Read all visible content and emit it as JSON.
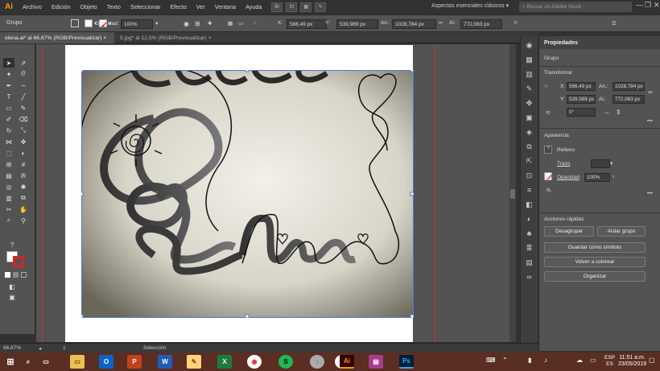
{
  "app": {
    "logo": "Ai",
    "menu": [
      "Archivo",
      "Edición",
      "Objeto",
      "Texto",
      "Seleccionar",
      "Efecto",
      "Ver",
      "Ventana",
      "Ayuda"
    ],
    "bridge_icons": [
      "Br",
      "St"
    ],
    "workspace": "Aspectos esenciales clásicos",
    "search_placeholder": "Buscar en Adobe Stock",
    "window_controls": [
      "—",
      "❐",
      "✕"
    ]
  },
  "control_bar": {
    "selection_label": "Grupo",
    "opacity_label": "Opacidad:",
    "opacity_value": "100%",
    "x_label": "X:",
    "x_value": "566,49 px",
    "y_label": "Y:",
    "y_value": "539,989 px",
    "w_label": "An.:",
    "w_value": "1028,784 px",
    "h_label": "Al.:",
    "h_value": "772,063 px"
  },
  "tabs": [
    {
      "label": "elena.ai* al 66,67% (RGB/Previsualizar)",
      "close": "×"
    },
    {
      "label": "5.jpg* al 12,5% (RGB/Previsualizar)",
      "close": "×"
    }
  ],
  "status": {
    "zoom": "66,67%",
    "artboard": "1",
    "tool": "Selección"
  },
  "properties": {
    "tab": "Propiedades",
    "group_label": "Grupo",
    "transform_title": "Transformar",
    "x_label": "X:",
    "x_value": "566,49 px",
    "y_label": "Y:",
    "y_value": "539,989 px",
    "w_label": "An.:",
    "w_value": "1028,784 px",
    "h_label": "Al.:",
    "h_value": "772,063 px",
    "angle_value": "0°",
    "appearance_title": "Apariencia",
    "fill_label": "Relleno",
    "stroke_label": "Trazo",
    "opacity_label": "Opacidad",
    "opacity_value": "100%",
    "fx_label": "fx.",
    "quick_actions_title": "Acciones rápidas",
    "buttons": {
      "ungroup": "Desagrupar",
      "isolate": "Aislar grupo",
      "save_symbol": "Guardar como símbolo",
      "recolor": "Volver a colorear",
      "arrange": "Organizar"
    }
  },
  "taskbar": {
    "time": "11:51 a.m.",
    "date": "23/05/2019",
    "lang_top": "ESP",
    "lang_bottom": "ES",
    "app_letters": [
      "O",
      "P",
      "W",
      "X",
      "S",
      "w",
      "Ai",
      "Ps"
    ]
  },
  "colors": {
    "accent_ai": "#ff9a00",
    "taskbar": "#5a2e22",
    "guide": "#c0392b",
    "selection": "#4a7bd4"
  }
}
